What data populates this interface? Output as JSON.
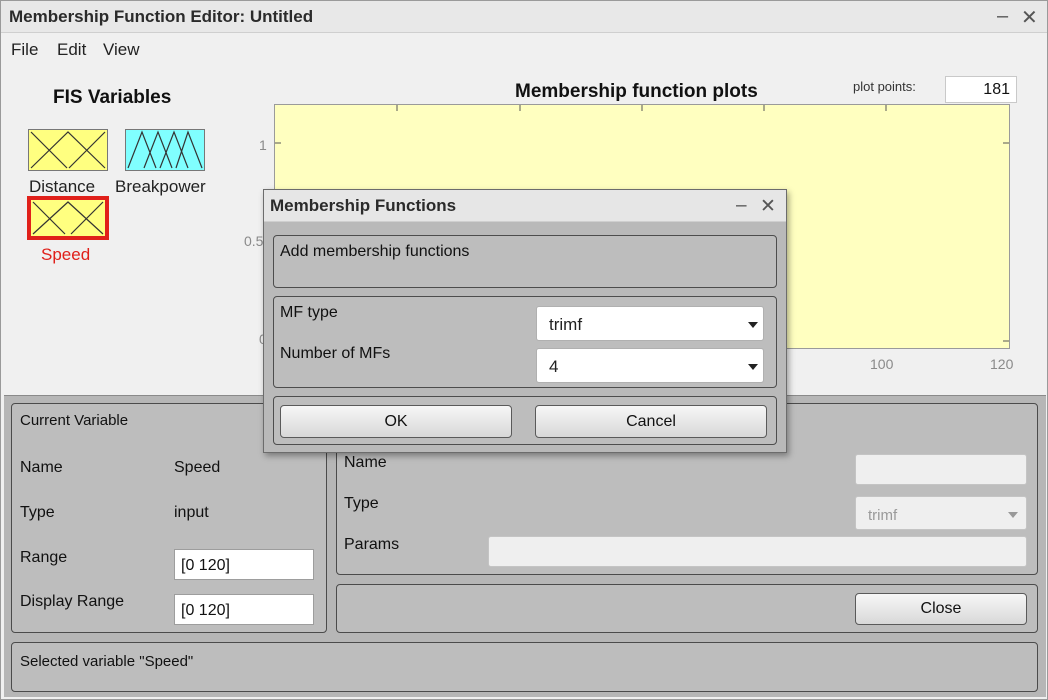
{
  "window": {
    "title": "Membership Function Editor: Untitled"
  },
  "menu": [
    "File",
    "Edit",
    "View"
  ],
  "fis": {
    "title": "FIS Variables",
    "variables": [
      {
        "name": "Distance",
        "kind": "input",
        "color": "#ffff80"
      },
      {
        "name": "Breakpower",
        "kind": "output",
        "color": "#80ffff"
      },
      {
        "name": "Speed",
        "kind": "input",
        "color": "#ffff80",
        "selected": true
      }
    ]
  },
  "plot": {
    "title": "Membership function plots",
    "plot_points_label": "plot points:",
    "plot_points_value": "181",
    "y_ticks": [
      "1",
      "0.5",
      "0"
    ],
    "x_ticks": [
      "100",
      "120"
    ],
    "background": "#ffffc0"
  },
  "current_variable": {
    "header": "Current Variable",
    "name_label": "Name",
    "name_value": "Speed",
    "type_label": "Type",
    "type_value": "input",
    "range_label": "Range",
    "range_value": "[0 120]",
    "display_range_label": "Display Range",
    "display_range_value": "[0 120]"
  },
  "current_mf": {
    "name_label": "Name",
    "type_label": "Type",
    "type_value": "trimf",
    "params_label": "Params",
    "close_label": "Close"
  },
  "status": "Selected variable \"Speed\"",
  "dialog": {
    "title": "Membership Functions",
    "instruction": "Add membership functions",
    "mf_type_label": "MF type",
    "mf_type_value": "trimf",
    "num_mfs_label": "Number of MFs",
    "num_mfs_value": "4",
    "ok_label": "OK",
    "cancel_label": "Cancel"
  }
}
